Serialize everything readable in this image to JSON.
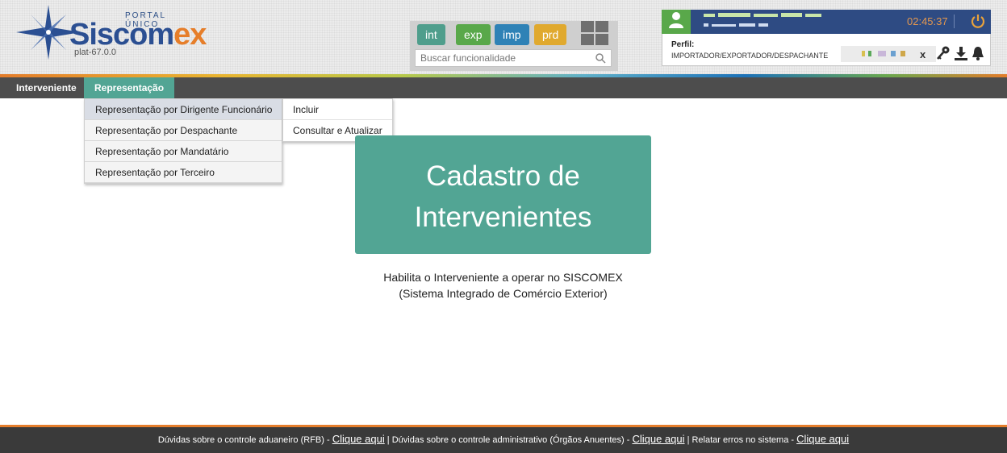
{
  "header": {
    "logo": {
      "portal": "PORTAL ÚNICO",
      "name_main": "Siscom",
      "name_accent": "ex",
      "version": "plat-67.0.0"
    },
    "modules": [
      "int",
      "exp",
      "imp",
      "prd"
    ],
    "search": {
      "placeholder": "Buscar funcionalidade",
      "value": ""
    },
    "user": {
      "clock": "02:45:37",
      "perfil_label": "Perfil:",
      "perfil_value": "IMPORTADOR/EXPORTADOR/DESPACHANTE",
      "perfil_clear": "x"
    }
  },
  "nav": {
    "items": [
      "Interveniente",
      "Representação"
    ],
    "active": "Representação"
  },
  "menu": {
    "items": [
      "Representação por Dirigente Funcionário",
      "Representação por Despachante",
      "Representação por Mandatário",
      "Representação por Terceiro"
    ],
    "submenu": [
      "Incluir",
      "Consultar e Atualizar"
    ]
  },
  "main": {
    "title_line1": "Cadastro de",
    "title_line2": "Intervenientes",
    "desc_line1": "Habilita o Interveniente a operar no SISCOMEX",
    "desc_line2": "(Sistema Integrado de Comércio Exterior)"
  },
  "footer": {
    "text1": "Dúvidas sobre o controle aduaneiro (RFB) - ",
    "link1": "Clique aqui",
    "text2": " | Dúvidas sobre o controle administrativo (Órgãos Anuentes) - ",
    "link2": "Clique aqui",
    "text3": " | Relatar erros no sistema - ",
    "link3": "Clique aqui"
  },
  "colors": {
    "accent": "#52a594",
    "brand_blue": "#2b4f92",
    "brand_orange": "#e67e2a",
    "module_int": "#4f9e8c",
    "module_exp": "#59a84a",
    "module_imp": "#2f82b6",
    "module_prd": "#e0a92e",
    "user_bar": "#2e4b83",
    "navbar": "#4d4d4d",
    "footer": "#3a3a3a"
  },
  "icons": [
    "compass-star-icon",
    "apps-grid-icon",
    "search-icon",
    "user-avatar-icon",
    "power-icon",
    "key-icon",
    "download-icon",
    "bell-icon"
  ]
}
